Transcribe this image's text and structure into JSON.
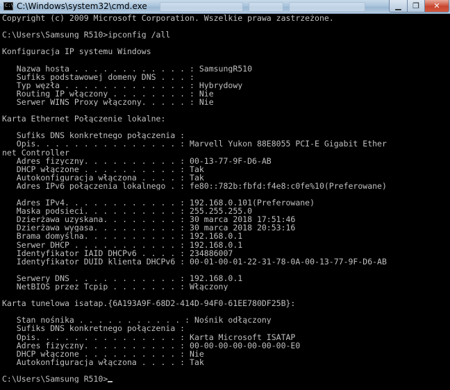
{
  "window": {
    "title": "C:\\Windows\\system32\\cmd.exe",
    "icon_label": "C:\\",
    "icons": {
      "app": "cmd-icon",
      "minimize": "minimize-icon",
      "maximize": "maximize-icon",
      "close": "close-icon"
    },
    "buttons": {
      "minimize": "▁",
      "maximize": "❐",
      "close": "✕"
    },
    "colors": {
      "background": "#000000",
      "text": "#c0c0c0",
      "title_bar": "#a9c4dc",
      "close_button": "#c8452f"
    }
  },
  "console": {
    "lines": [
      "Copyright (c) 2009 Microsoft Corporation. Wszelkie prawa zastrzeżone.",
      "",
      "C:\\Users\\Samsung R510>ipconfig /all",
      "",
      "Konfiguracja IP systemu Windows",
      "",
      "   Nazwa hosta . . . . . . . . . . . . : SamsungR510",
      "   Sufiks podstawowej domeny DNS . . . :",
      "   Typ węzła . . . . . . . . . . . . . : Hybrydowy",
      "   Routing IP włączony . . . . . . . . : Nie",
      "   Serwer WINS Proxy włączony. . . . . : Nie",
      "",
      "Karta Ethernet Połączenie lokalne:",
      "",
      "   Sufiks DNS konkretnego połączenia :",
      "   Opis. . . . . . . . . . . . . . . : Marvell Yukon 88E8055 PCI-E Gigabit Ether",
      "net Controller",
      "   Adres fizyczny. . . . . . . . . . : 00-13-77-9F-D6-AB",
      "   DHCP włączone . . . . . . . . . . : Tak",
      "   Autokonfiguracja włączona . . . . : Tak",
      "   Adres IPv6 połączenia lokalnego . : fe80::782b:fbfd:f4e8:c0fe%10(Preferowane)",
      "",
      "   Adres IPv4. . . . . . . . . . . . : 192.168.0.101(Preferowane)",
      "   Maska podsieci. . . . . . . . . . : 255.255.255.0",
      "   Dzierżawa uzyskana. . . . . . . . : 30 marca 2018 17:51:46",
      "   Dzierżawa wygasa. . . . . . . . . : 30 marca 2018 20:53:16",
      "   Brama domyślna. . . . . . . . . . : 192.168.0.1",
      "   Serwer DHCP . . . . . . . . . . . : 192.168.0.1",
      "   Identyfikator IAID DHCPv6 . . . . : 234886007",
      "   Identyfikator DUID klienta DHCPv6 : 00-01-00-01-22-31-78-0A-00-13-77-9F-D6-AB",
      "",
      "   Serwery DNS . . . . . . . . . . . : 192.168.0.1",
      "   NetBIOS przez Tcpip . . . . . . . : Włączony",
      "",
      "Karta tunelowa isatap.{6A193A9F-68D2-414D-94F0-61EE780DF25B}:",
      "",
      "   Stan nośnika . . . . . . . . . . . : Nośnik odłączony",
      "   Sufiks DNS konkretnego połączenia :",
      "   Opis. . . . . . . . . . . . . . . : Karta Microsoft ISATAP",
      "   Adres fizyczny. . . . . . . . . . : 00-00-00-00-00-00-00-E0",
      "   DHCP włączone . . . . . . . . . . : Nie",
      "   Autokonfiguracja włączona . . . . : Tak",
      "",
      "C:\\Users\\Samsung R510>"
    ]
  }
}
